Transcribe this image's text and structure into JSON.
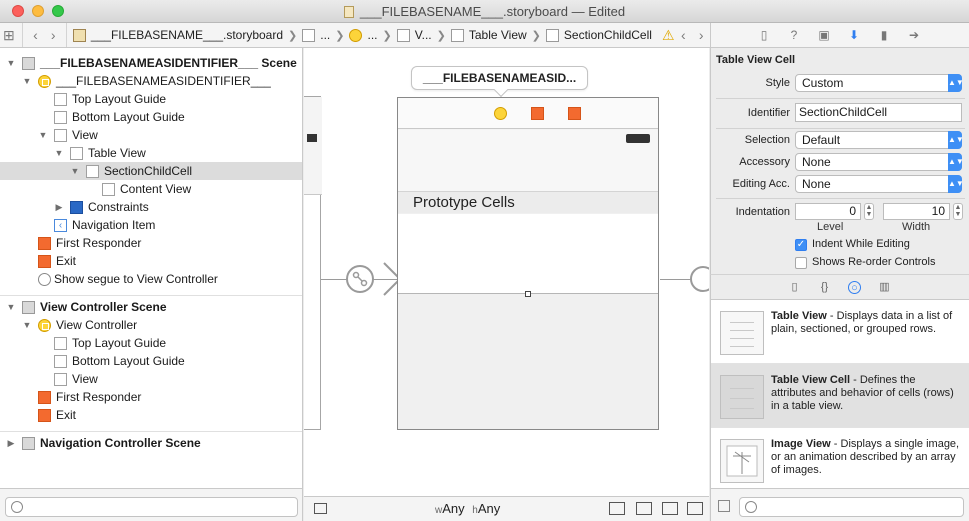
{
  "window": {
    "title": "___FILEBASENAME___.storyboard — Edited"
  },
  "jumpbar": {
    "crumbs": [
      "___FILEBASENAME___.storyboard",
      "...",
      "...",
      "V...",
      "Table View",
      "SectionChildCell"
    ]
  },
  "outline": {
    "rows": [
      {
        "label": "___FILEBASENAMEASIDENTIFIER___ Scene"
      },
      {
        "label": "___FILEBASENAMEASIDENTIFIER___"
      },
      {
        "label": "Top Layout Guide"
      },
      {
        "label": "Bottom Layout Guide"
      },
      {
        "label": "View"
      },
      {
        "label": "Table View"
      },
      {
        "label": "SectionChildCell"
      },
      {
        "label": "Content View"
      },
      {
        "label": "Constraints"
      },
      {
        "label": "Navigation Item"
      },
      {
        "label": "First Responder"
      },
      {
        "label": "Exit"
      },
      {
        "label": "Show segue to View Controller"
      },
      {
        "label": "View Controller Scene"
      },
      {
        "label": "View Controller"
      },
      {
        "label": "Top Layout Guide"
      },
      {
        "label": "Bottom Layout Guide"
      },
      {
        "label": "View"
      },
      {
        "label": "First Responder"
      },
      {
        "label": "Exit"
      },
      {
        "label": "Navigation Controller Scene"
      }
    ]
  },
  "canvas": {
    "scene_title": "___FILEBASENAMEASID...",
    "prototype_header": "Prototype Cells",
    "size_class": {
      "w_prefix": "w",
      "w_value": "Any",
      "h_prefix": "h",
      "h_value": "Any"
    }
  },
  "inspector": {
    "section_title": "Table View Cell",
    "style_label": "Style",
    "style_value": "Custom",
    "identifier_label": "Identifier",
    "identifier_value": "SectionChildCell",
    "selection_label": "Selection",
    "selection_value": "Default",
    "accessory_label": "Accessory",
    "accessory_value": "None",
    "editing_acc_label": "Editing Acc.",
    "editing_acc_value": "None",
    "indentation_label": "Indentation",
    "level_value": "0",
    "level_label": "Level",
    "width_value": "10",
    "width_label": "Width",
    "indent_while_editing_label": "Indent While Editing",
    "indent_while_editing_checked": true,
    "show_reorder_label": "Shows Re-order Controls",
    "show_reorder_checked": false
  },
  "library": {
    "items": [
      {
        "title": "Table View",
        "desc": " - Displays data in a list of plain, sectioned, or grouped rows."
      },
      {
        "title": "Table View Cell",
        "desc": " - Defines the attributes and behavior of cells (rows) in a table view."
      },
      {
        "title": "Image View",
        "desc": " - Displays a single image, or an animation described by an array of images."
      }
    ]
  },
  "colors": {
    "accent": "#3e8ff5",
    "view_controller_icon": "#fcd43a",
    "first_responder_icon": "#f36a2f",
    "selected_row": "#dcdcdc"
  }
}
